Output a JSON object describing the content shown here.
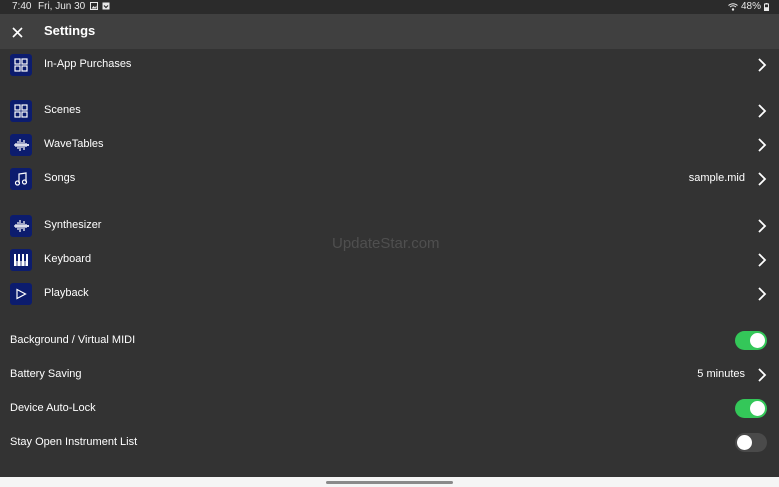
{
  "status_bar": {
    "time": "7:40",
    "date": "Fri, Jun 30",
    "battery": "48%"
  },
  "app_bar": {
    "title": "Settings"
  },
  "rows": {
    "in_app": {
      "label": "In-App Purchases",
      "icon": "grid-icon"
    },
    "scenes": {
      "label": "Scenes",
      "icon": "grid-icon"
    },
    "wavetables": {
      "label": "WaveTables",
      "icon": "waveform-icon"
    },
    "songs": {
      "label": "Songs",
      "value": "sample.mid",
      "icon": "music-note-icon"
    },
    "synthesizer": {
      "label": "Synthesizer",
      "icon": "waveform-icon"
    },
    "keyboard": {
      "label": "Keyboard",
      "icon": "piano-keys-icon"
    },
    "playback": {
      "label": "Playback",
      "icon": "play-icon"
    },
    "background_midi": {
      "label": "Background / Virtual MIDI",
      "enabled": true
    },
    "battery_saving": {
      "label": "Battery Saving",
      "value": "5 minutes"
    },
    "auto_lock": {
      "label": "Device Auto-Lock",
      "enabled": true
    },
    "stay_open": {
      "label": "Stay Open Instrument List",
      "enabled": false
    }
  },
  "watermark": "UpdateStar.com",
  "colors": {
    "background": "#333333",
    "app_bar": "#404040",
    "icon_bg": "#0c1c6e",
    "toggle_on": "#34c759",
    "toggle_off": "#4a4a4a"
  }
}
